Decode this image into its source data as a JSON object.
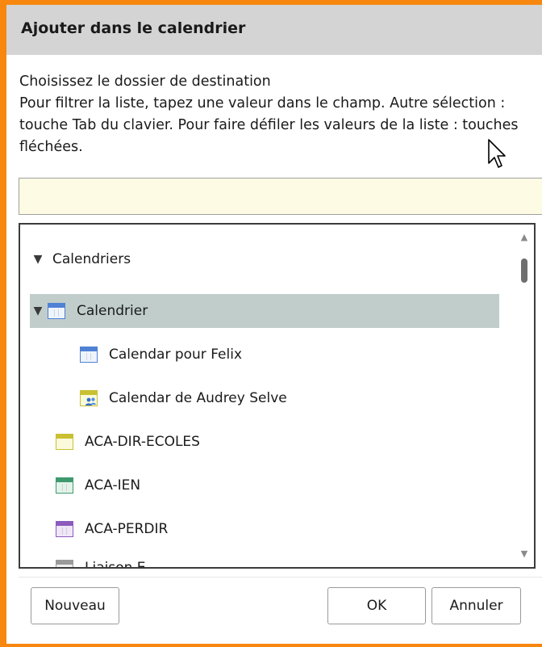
{
  "dialog": {
    "title": "Ajouter dans le calendrier",
    "instruction_line1": "Choisissez le dossier de destination",
    "instruction_line2": "Pour filtrer la liste, tapez une valeur dans le champ. Autre sélection : touche Tab du clavier. Pour faire défiler les valeurs de la liste : touches fléchées.",
    "filter_value": ""
  },
  "tree": {
    "root": {
      "label": "Calendriers",
      "expanded": true,
      "icon": "caret-down-icon"
    },
    "items": [
      {
        "label": "Calendrier",
        "expanded": true,
        "selected": true,
        "icon": "calendar-icon",
        "color": "#4f81d4"
      },
      {
        "label": "Calendar pour Felix",
        "icon": "calendar-icon",
        "color": "#4f81d4"
      },
      {
        "label": "Calendar de Audrey Selve",
        "icon": "shared-calendar-icon",
        "color": "#c9c032"
      },
      {
        "label": "ACA-DIR-ECOLES",
        "icon": "calendar-icon",
        "color": "#c9c032"
      },
      {
        "label": "ACA-IEN",
        "icon": "calendar-icon",
        "color": "#3e9a6e"
      },
      {
        "label": "ACA-PERDIR",
        "icon": "calendar-icon",
        "color": "#8c5bbd"
      },
      {
        "label": "Liaison E...",
        "icon": "calendar-icon",
        "color": "#9a9a9a"
      }
    ]
  },
  "buttons": {
    "new_label": "Nouveau",
    "ok_label": "OK",
    "cancel_label": "Annuler"
  },
  "colors": {
    "frame_border": "#f7870f",
    "selected_row": "#c0cdcb",
    "filter_bg": "#fdfbe3"
  }
}
